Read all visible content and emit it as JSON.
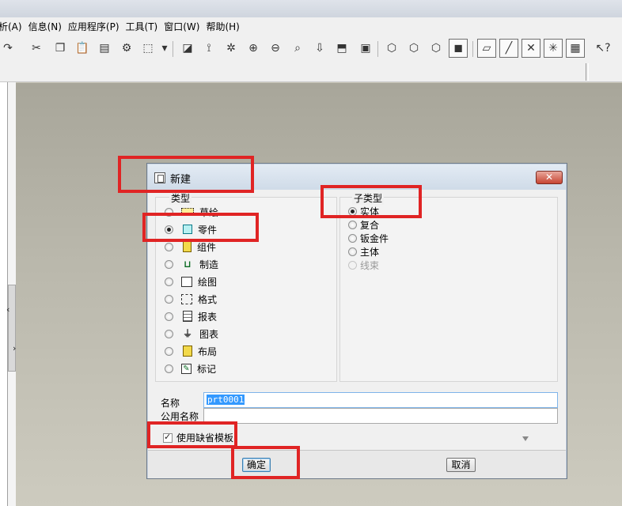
{
  "menubar": {
    "items": [
      "析(A)",
      "信息(N)",
      "应用程序(P)",
      "工具(T)",
      "窗口(W)",
      "帮助(H)"
    ]
  },
  "toolbar": {
    "icons": [
      "redo-icon",
      "cut-icon",
      "copy-icon",
      "paste-icon",
      "paste-special-icon",
      "regenerate-icon",
      "select-box-icon",
      "repaint-icon",
      "spin-center-icon",
      "orient-icon",
      "zoom-in-icon",
      "zoom-out-icon",
      "refit-icon",
      "view-manager-icon",
      "named-views-icon",
      "layers-icon",
      "wireframe-icon",
      "hidden-line-icon",
      "no-hidden-icon",
      "shading-icon",
      "datum-plane-icon",
      "datum-axis-icon",
      "datum-point-icon",
      "coordinate-system-icon",
      "annotation-icon",
      "help-whats-this-icon"
    ]
  },
  "dialog": {
    "title": "新建",
    "type_group_label": "类型",
    "subtype_group_label": "子类型",
    "types": [
      {
        "label": "草绘",
        "icon": "sketch-icon",
        "selected": false
      },
      {
        "label": "零件",
        "icon": "part-icon",
        "selected": true
      },
      {
        "label": "组件",
        "icon": "assembly-icon",
        "selected": false
      },
      {
        "label": "制造",
        "icon": "manufacturing-icon",
        "selected": false
      },
      {
        "label": "绘图",
        "icon": "drawing-icon",
        "selected": false
      },
      {
        "label": "格式",
        "icon": "format-icon",
        "selected": false
      },
      {
        "label": "报表",
        "icon": "report-icon",
        "selected": false
      },
      {
        "label": "图表",
        "icon": "diagram-icon",
        "selected": false
      },
      {
        "label": "布局",
        "icon": "layout-icon",
        "selected": false
      },
      {
        "label": "标记",
        "icon": "markup-icon",
        "selected": false
      }
    ],
    "subtypes": [
      {
        "label": "实体",
        "selected": true,
        "enabled": true
      },
      {
        "label": "复合",
        "selected": false,
        "enabled": true
      },
      {
        "label": "钣金件",
        "selected": false,
        "enabled": true
      },
      {
        "label": "主体",
        "selected": false,
        "enabled": true
      },
      {
        "label": "线束",
        "selected": false,
        "enabled": false
      }
    ],
    "name_label": "名称",
    "name_value": "prt0001",
    "common_name_label": "公用名称",
    "common_name_value": "",
    "use_default_template_label": "使用缺省模板",
    "use_default_template_checked": true,
    "ok_label": "确定",
    "cancel_label": "取消",
    "close_glyph": "✕"
  },
  "colors": {
    "highlight": "#e02424",
    "canvas_top": "#a8a69a",
    "canvas_bottom": "#cdcbbf"
  }
}
